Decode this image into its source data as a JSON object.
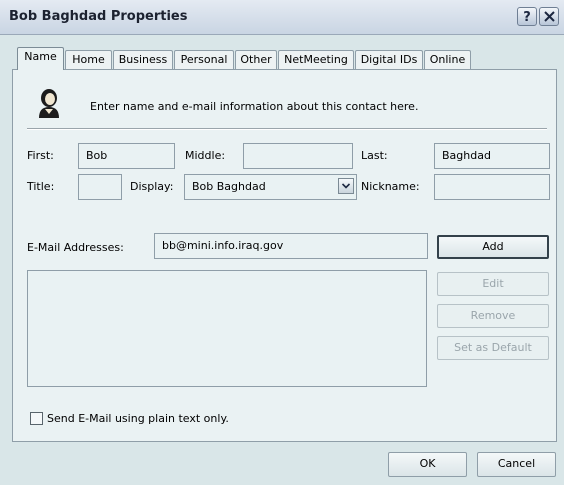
{
  "window": {
    "title": "Bob Baghdad Properties",
    "help_glyph": "?"
  },
  "tabs": [
    {
      "label": "Name",
      "active": true
    },
    {
      "label": "Home"
    },
    {
      "label": "Business"
    },
    {
      "label": "Personal"
    },
    {
      "label": "Other"
    },
    {
      "label": "NetMeeting"
    },
    {
      "label": "Digital IDs"
    },
    {
      "label": "Online"
    }
  ],
  "header": {
    "icon": "contact-person-icon",
    "text": "Enter name and e-mail information about this contact here."
  },
  "name_fields": {
    "first_label": "First:",
    "first_value": "Bob",
    "middle_label": "Middle:",
    "middle_value": "",
    "last_label": "Last:",
    "last_value": "Baghdad",
    "title_label": "Title:",
    "title_value": "",
    "display_label": "Display:",
    "display_value": "Bob Baghdad",
    "nickname_label": "Nickname:",
    "nickname_value": ""
  },
  "email": {
    "label": "E-Mail Addresses:",
    "input_value": "bb@mini.info.iraq.gov",
    "addresses": [],
    "add_label": "Add",
    "edit_label": "Edit",
    "remove_label": "Remove",
    "default_label": "Set as Default",
    "plain_text_label": "Send E-Mail using plain text only.",
    "plain_text_checked": false
  },
  "footer": {
    "ok_label": "OK",
    "cancel_label": "Cancel"
  },
  "colors": {
    "dialog_bg": "#d9e6e8",
    "panel_bg": "#eaf2f3",
    "field_border": "#8f9ea8"
  }
}
